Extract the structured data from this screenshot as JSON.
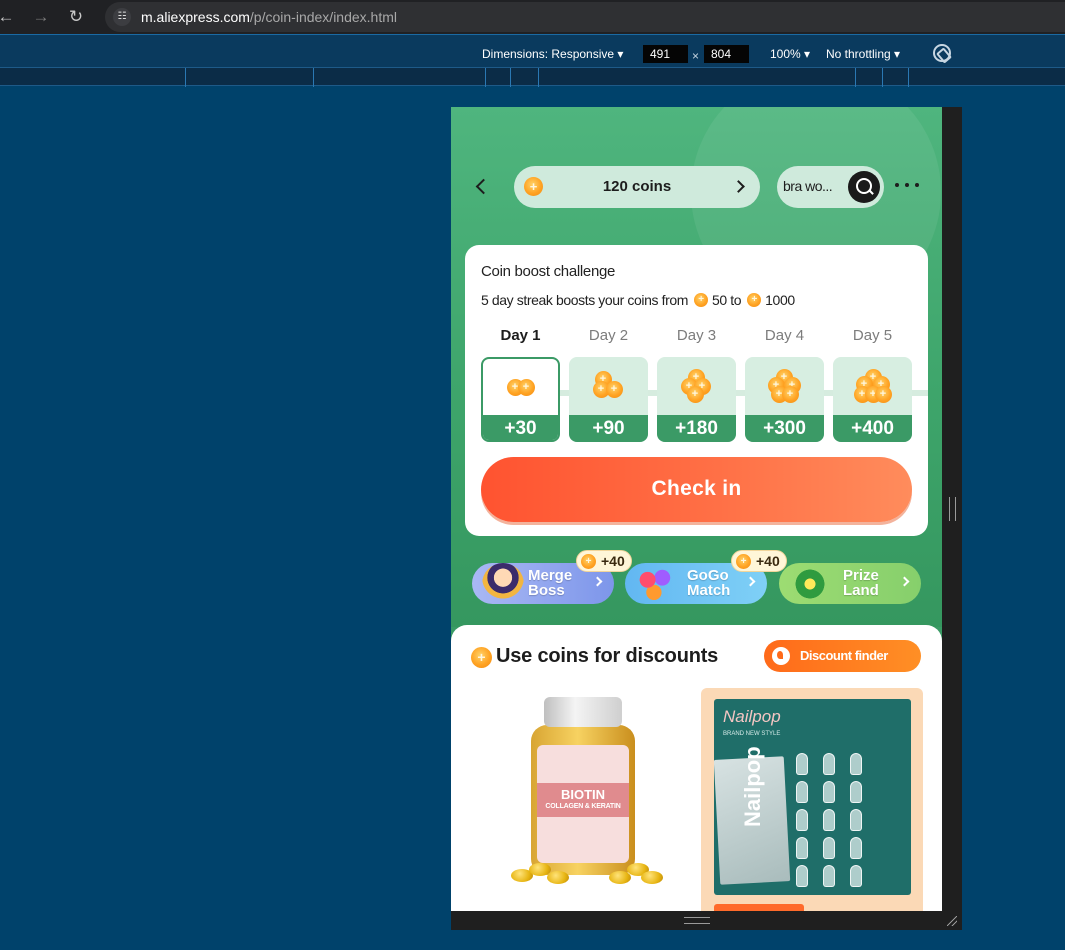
{
  "browser": {
    "url_host": "m.aliexpress.com",
    "url_path": "/p/coin-index/index.html"
  },
  "devtools": {
    "dimensions_label": "Dimensions: Responsive",
    "width": "491",
    "height": "804",
    "times": "×",
    "zoom": "100%",
    "throttling": "No throttling"
  },
  "header": {
    "coins_label": "120 coins",
    "search_text": "bra wo..."
  },
  "challenge": {
    "title": "Coin boost challenge",
    "subtitle_prefix": "5 day streak boosts your coins from",
    "from_value": "50",
    "to_word": "to",
    "to_value": "1000",
    "days": [
      {
        "label": "Day 1",
        "reward": "+30",
        "active": true
      },
      {
        "label": "Day 2",
        "reward": "+90",
        "active": false
      },
      {
        "label": "Day 3",
        "reward": "+180",
        "active": false
      },
      {
        "label": "Day 4",
        "reward": "+300",
        "active": false
      },
      {
        "label": "Day 5",
        "reward": "+400",
        "active": false
      }
    ],
    "checkin_label": "Check in"
  },
  "games": [
    {
      "line1": "Merge",
      "line2": "Boss",
      "badge": "+40",
      "color": "#8ea6ee"
    },
    {
      "line1": "GoGo",
      "line2": "Match",
      "badge": "+40",
      "color": "#67bdf2"
    },
    {
      "line1": "Prize",
      "line2": "Land",
      "badge": "",
      "color": "#8fd66f"
    }
  ],
  "discounts": {
    "title": "Use coins for discounts",
    "finder_label": "Discount finder"
  },
  "products": {
    "p1_name": "BIOTIN",
    "p1_sub": "COLLAGEN & KERATIN",
    "p2_brand_a": "Nail",
    "p2_brand_b": "pop",
    "p2_small": "BRAND NEW STYLE",
    "p2_vertical": "Nailpop"
  },
  "colors": {
    "accent_green": "#3b9a66",
    "checkin_orange": "#ff5330",
    "coin_gold": "#ffa323"
  }
}
